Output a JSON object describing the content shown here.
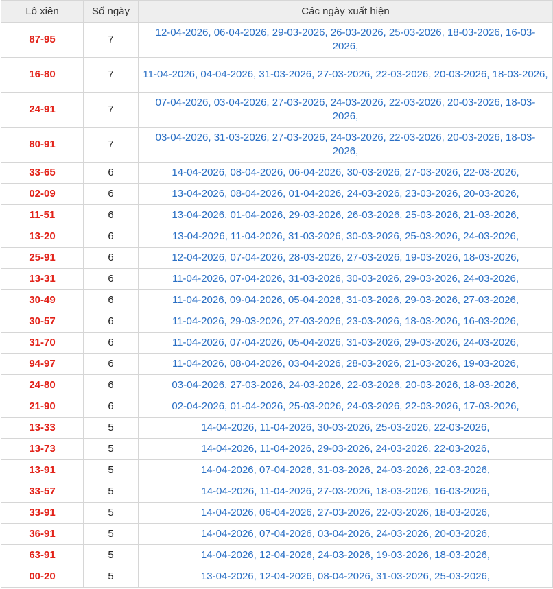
{
  "header": {
    "col_pair": "Lô xiên",
    "col_count": "Số ngày",
    "col_dates": "Các ngày xuất hiện"
  },
  "colors": {
    "pair": "#e2231a",
    "dates": "#2a6fc4",
    "header_bg": "#eeeeee",
    "border": "#d6d6d6"
  },
  "rows": [
    {
      "pair": "87-95",
      "count": "7",
      "dates": "12-04-2026, 06-04-2026, 29-03-2026, 26-03-2026, 25-03-2026, 18-03-2026, 16-03-2026,"
    },
    {
      "pair": "16-80",
      "count": "7",
      "dates": "11-04-2026, 04-04-2026, 31-03-2026, 27-03-2026, 22-03-2026, 20-03-2026, 18-03-2026,"
    },
    {
      "pair": "24-91",
      "count": "7",
      "dates": "07-04-2026, 03-04-2026, 27-03-2026, 24-03-2026, 22-03-2026, 20-03-2026, 18-03-2026,"
    },
    {
      "pair": "80-91",
      "count": "7",
      "dates": "03-04-2026, 31-03-2026, 27-03-2026, 24-03-2026, 22-03-2026, 20-03-2026, 18-03-2026,"
    },
    {
      "pair": "33-65",
      "count": "6",
      "dates": "14-04-2026, 08-04-2026, 06-04-2026, 30-03-2026, 27-03-2026, 22-03-2026,"
    },
    {
      "pair": "02-09",
      "count": "6",
      "dates": "13-04-2026, 08-04-2026, 01-04-2026, 24-03-2026, 23-03-2026, 20-03-2026,"
    },
    {
      "pair": "11-51",
      "count": "6",
      "dates": "13-04-2026, 01-04-2026, 29-03-2026, 26-03-2026, 25-03-2026, 21-03-2026,"
    },
    {
      "pair": "13-20",
      "count": "6",
      "dates": "13-04-2026, 11-04-2026, 31-03-2026, 30-03-2026, 25-03-2026, 24-03-2026,"
    },
    {
      "pair": "25-91",
      "count": "6",
      "dates": "12-04-2026, 07-04-2026, 28-03-2026, 27-03-2026, 19-03-2026, 18-03-2026,"
    },
    {
      "pair": "13-31",
      "count": "6",
      "dates": "11-04-2026, 07-04-2026, 31-03-2026, 30-03-2026, 29-03-2026, 24-03-2026,"
    },
    {
      "pair": "30-49",
      "count": "6",
      "dates": "11-04-2026, 09-04-2026, 05-04-2026, 31-03-2026, 29-03-2026, 27-03-2026,"
    },
    {
      "pair": "30-57",
      "count": "6",
      "dates": "11-04-2026, 29-03-2026, 27-03-2026, 23-03-2026, 18-03-2026, 16-03-2026,"
    },
    {
      "pair": "31-70",
      "count": "6",
      "dates": "11-04-2026, 07-04-2026, 05-04-2026, 31-03-2026, 29-03-2026, 24-03-2026,"
    },
    {
      "pair": "94-97",
      "count": "6",
      "dates": "11-04-2026, 08-04-2026, 03-04-2026, 28-03-2026, 21-03-2026, 19-03-2026,"
    },
    {
      "pair": "24-80",
      "count": "6",
      "dates": "03-04-2026, 27-03-2026, 24-03-2026, 22-03-2026, 20-03-2026, 18-03-2026,"
    },
    {
      "pair": "21-90",
      "count": "6",
      "dates": "02-04-2026, 01-04-2026, 25-03-2026, 24-03-2026, 22-03-2026, 17-03-2026,"
    },
    {
      "pair": "13-33",
      "count": "5",
      "dates": "14-04-2026, 11-04-2026, 30-03-2026, 25-03-2026, 22-03-2026,"
    },
    {
      "pair": "13-73",
      "count": "5",
      "dates": "14-04-2026, 11-04-2026, 29-03-2026, 24-03-2026, 22-03-2026,"
    },
    {
      "pair": "13-91",
      "count": "5",
      "dates": "14-04-2026, 07-04-2026, 31-03-2026, 24-03-2026, 22-03-2026,"
    },
    {
      "pair": "33-57",
      "count": "5",
      "dates": "14-04-2026, 11-04-2026, 27-03-2026, 18-03-2026, 16-03-2026,"
    },
    {
      "pair": "33-91",
      "count": "5",
      "dates": "14-04-2026, 06-04-2026, 27-03-2026, 22-03-2026, 18-03-2026,"
    },
    {
      "pair": "36-91",
      "count": "5",
      "dates": "14-04-2026, 07-04-2026, 03-04-2026, 24-03-2026, 20-03-2026,"
    },
    {
      "pair": "63-91",
      "count": "5",
      "dates": "14-04-2026, 12-04-2026, 24-03-2026, 19-03-2026, 18-03-2026,"
    },
    {
      "pair": "00-20",
      "count": "5",
      "dates": "13-04-2026, 12-04-2026, 08-04-2026, 31-03-2026, 25-03-2026,"
    }
  ]
}
